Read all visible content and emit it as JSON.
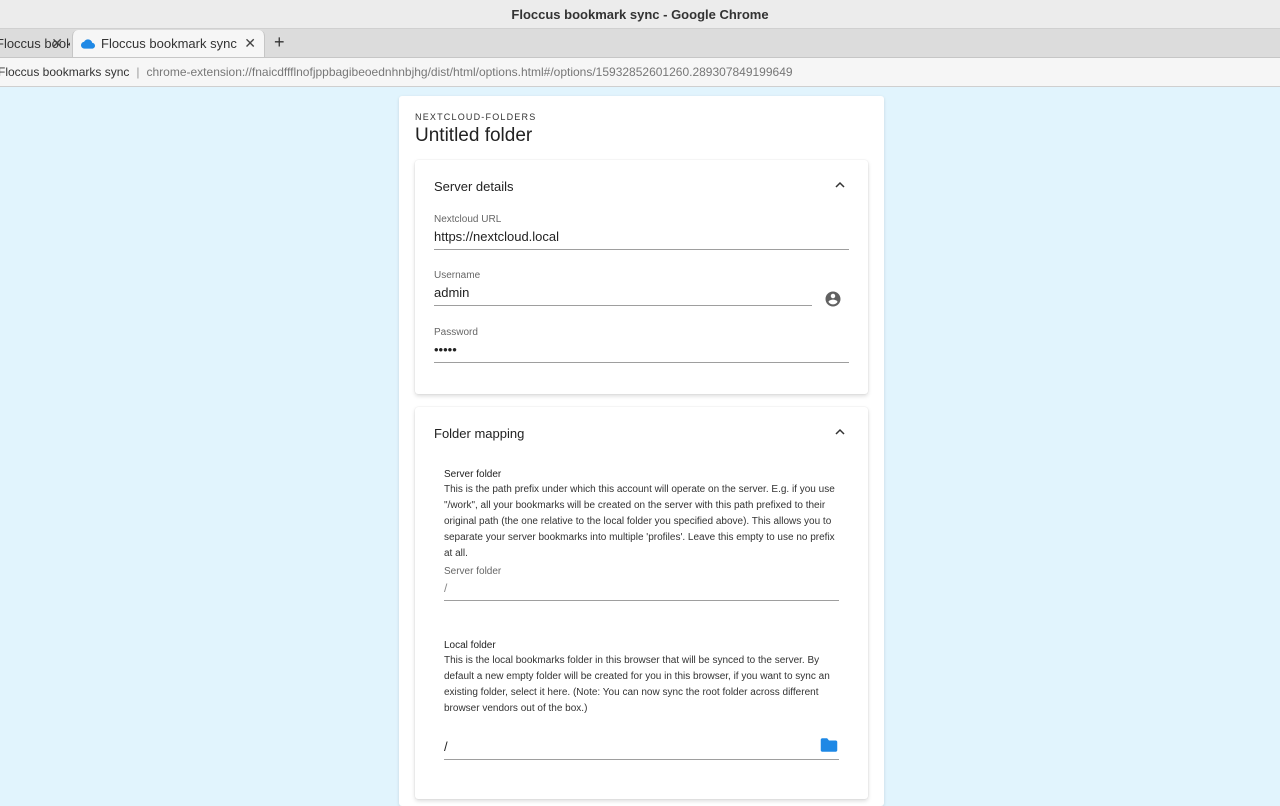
{
  "window": {
    "title": "Floccus bookmark sync - Google Chrome"
  },
  "tabs": [
    {
      "title": "Floccus bookmarks sync",
      "active": false
    },
    {
      "title": "Floccus bookmark sync",
      "active": true
    }
  ],
  "addressbar": {
    "site_name": "Floccus bookmarks sync",
    "url": "chrome-extension://fnaicdffflnofjppbagibeoednhnbjhg/dist/html/options.html#/options/15932852601260.289307849199649"
  },
  "account": {
    "type": "NEXTCLOUD-FOLDERS",
    "title": "Untitled folder"
  },
  "server_details": {
    "header": "Server details",
    "url_label": "Nextcloud URL",
    "url_value": "https://nextcloud.local",
    "username_label": "Username",
    "username_value": "admin",
    "password_label": "Password",
    "password_value": "•••••"
  },
  "folder_mapping": {
    "header": "Folder mapping",
    "server_folder_title": "Server folder",
    "server_folder_desc": "This is the path prefix under which this account will operate on the server. E.g. if you use \"/work\", all your bookmarks will be created on the server with this path prefixed to their original path (the one relative to the local folder you specified above). This allows you to separate your server bookmarks into multiple 'profiles'. Leave this empty to use no prefix at all.",
    "server_folder_label": "Server folder",
    "server_folder_value": "/",
    "local_folder_title": "Local folder",
    "local_folder_desc": "This is the local bookmarks folder in this browser that will be synced to the server. By default a new empty folder will be created for you in this browser, if you want to sync an existing folder, select it here. (Note: You can now sync the root folder across different browser vendors out of the box.)",
    "local_folder_value": "/"
  },
  "icons": {
    "account": "account-circle-icon",
    "folder": "folder-icon",
    "chevron": "chevron-up-icon",
    "cloud": "cloud-icon"
  },
  "colors": {
    "background": "#e1f4fd",
    "folder_icon": "#1e88e5",
    "cloud_icon": "#1e88e5"
  }
}
